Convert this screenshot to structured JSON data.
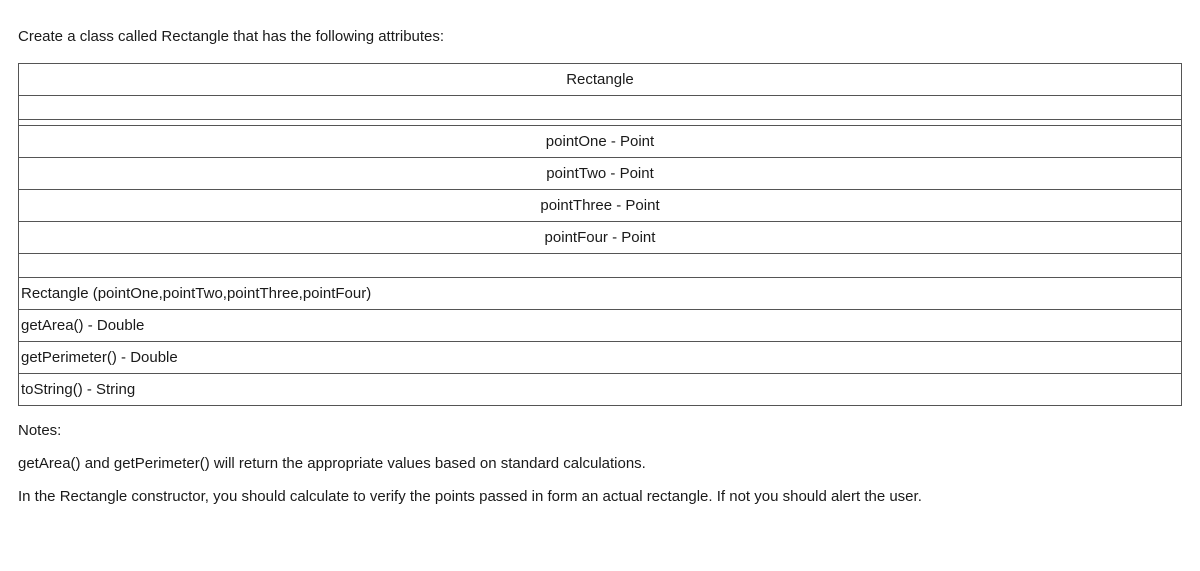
{
  "intro": "Create a class called Rectangle that has the following attributes:",
  "classTable": {
    "className": "Rectangle",
    "attributes": [
      "pointOne - Point",
      "pointTwo - Point",
      "pointThree - Point",
      "pointFour - Point"
    ],
    "methods": [
      "Rectangle (pointOne,pointTwo,pointThree,pointFour)",
      "getArea() - Double",
      "getPerimeter() - Double",
      "toString() - String"
    ]
  },
  "notes": {
    "heading": "Notes:",
    "line1": "getArea() and getPerimeter() will return the appropriate values based on standard calculations.",
    "line2": "In the Rectangle constructor, you should calculate to verify the points passed in form an actual rectangle. If not you should alert the user."
  }
}
